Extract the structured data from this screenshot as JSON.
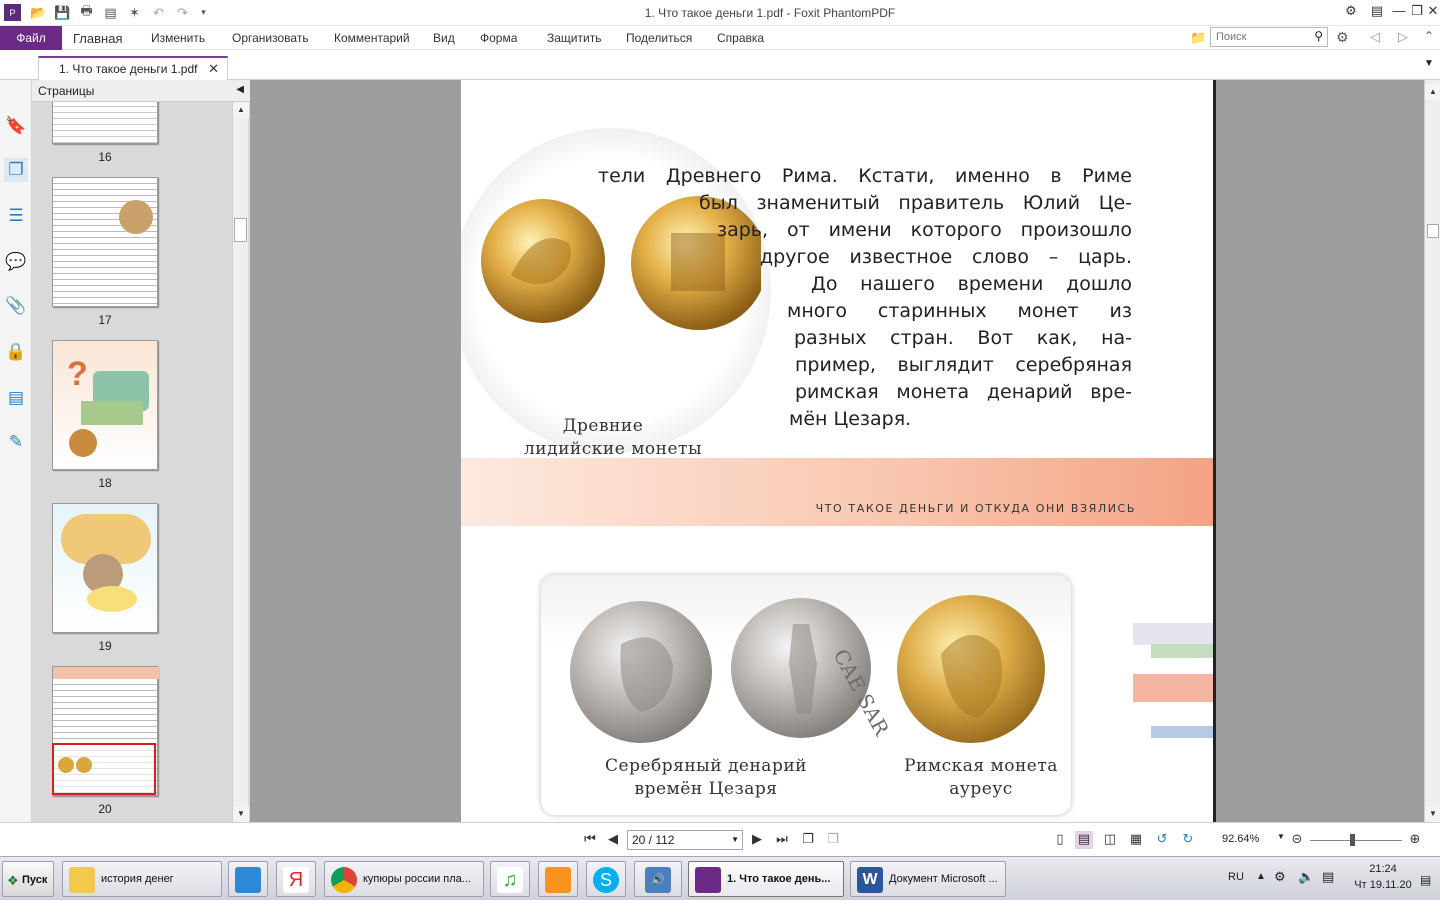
{
  "window": {
    "title": "1. Что такое деньги 1.pdf - Foxit PhantomPDF"
  },
  "menu": {
    "file": "Файл",
    "items": [
      "Главная",
      "Изменить",
      "Организовать",
      "Комментарий",
      "Вид",
      "Форма",
      "Защитить",
      "Поделиться",
      "Справка"
    ],
    "search_placeholder": "Поиск"
  },
  "tab": {
    "label": "1. Что такое деньги 1.pdf"
  },
  "panel": {
    "title": "Страницы",
    "thumbnails": [
      "16",
      "17",
      "18",
      "19",
      "20"
    ],
    "selected": "20"
  },
  "document": {
    "page1_lines": [
      "тели Древнего Рима. Кстати, именно в Риме",
      "был знаменитый правитель Юлий Це-",
      "зарь, от имени которого произошло",
      "другое известное слово – царь.",
      "До нашего времени дошло",
      "много старинных монет из",
      "разных стран. Вот как, на-",
      "пример, выглядит серебряная",
      "римская монета денарий вре-",
      "мён Цезаря."
    ],
    "caption_lydian": [
      "Древние",
      "лидийские монеты"
    ],
    "page2_header": "ЧТО ТАКОЕ ДЕНЬГИ И ОТКУДА ОНИ ВЗЯЛИСЬ",
    "caption_denarius": [
      "Серебряный денарий",
      "времён Цезаря"
    ],
    "caption_aureus": [
      "Римская монета",
      "ауреус"
    ],
    "coin_inscription": "CAE SAR"
  },
  "status": {
    "page": "20 / 112",
    "zoom": "92.64%"
  },
  "taskbar": {
    "start": "Пуск",
    "items": [
      "история денег",
      "купюры россии пла...",
      "1. Что такое день...",
      "Документ Microsoft ..."
    ],
    "lang": "RU",
    "time": "21:24",
    "date": "Чт 19.11.20"
  },
  "colors": {
    "accent": "#6a2a86",
    "header_band": "#f4a283"
  }
}
